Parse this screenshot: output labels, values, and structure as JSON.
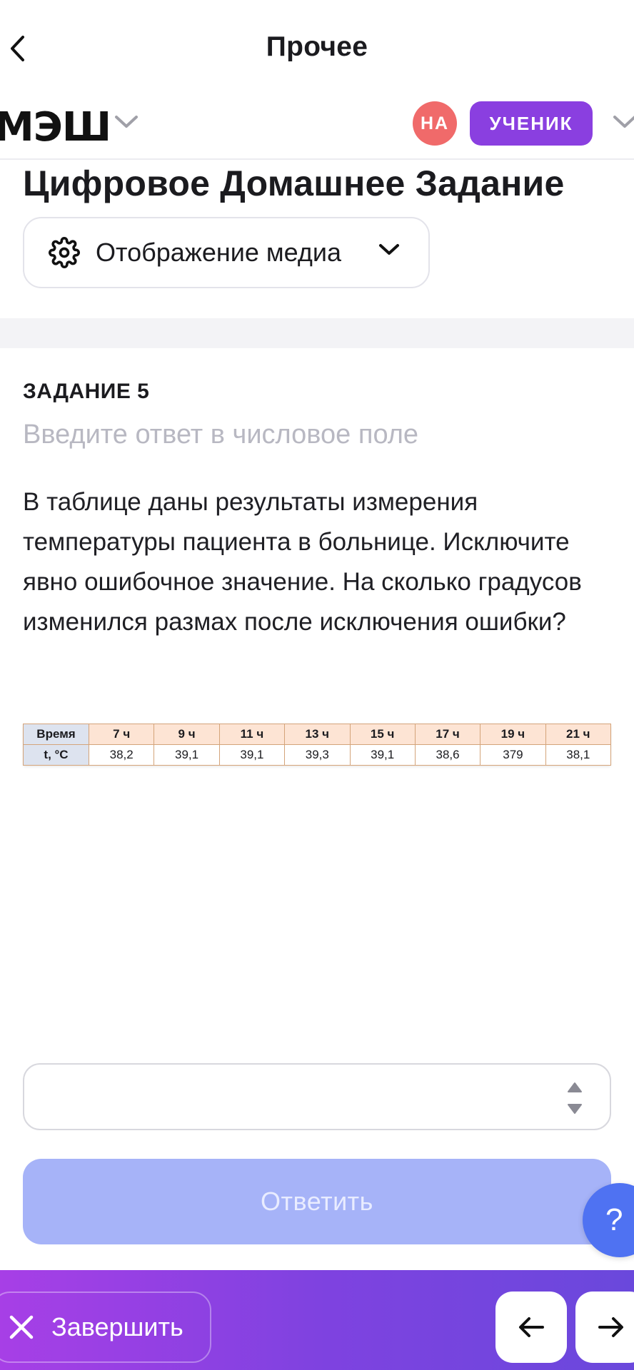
{
  "nav": {
    "title": "Прочее"
  },
  "brand": {
    "logo": "МЭШ",
    "avatar_initials": "НА",
    "role": "УЧЕНИК"
  },
  "header": {
    "title": "Цифровое Домашнее Задание",
    "media_label": "Отображение медиа"
  },
  "task": {
    "number": "ЗАДАНИЕ 5",
    "hint": "Введите ответ в числовое поле",
    "text": "В таблице даны результаты измерения температуры пациента в больнице. Исключите явно ошибочное значение. На сколько градусов изменился размах после исключения ошибки?",
    "table": {
      "row1_head": "Время",
      "row2_head": "t, °C",
      "times": [
        "7 ч",
        "9 ч",
        "11 ч",
        "13 ч",
        "15 ч",
        "17 ч",
        "19 ч",
        "21 ч"
      ],
      "temps": [
        "38,2",
        "39,1",
        "39,1",
        "39,3",
        "39,1",
        "38,6",
        "379",
        "38,1"
      ]
    },
    "answer_value": "",
    "submit_label": "Ответить"
  },
  "help_label": "?",
  "footer": {
    "finish_label": "Завершить"
  },
  "colors": {
    "accent": "#8a3fe0",
    "avatar": "#f06a6a",
    "submit_disabled": "#a6b3f8",
    "help": "#4f72f2"
  }
}
